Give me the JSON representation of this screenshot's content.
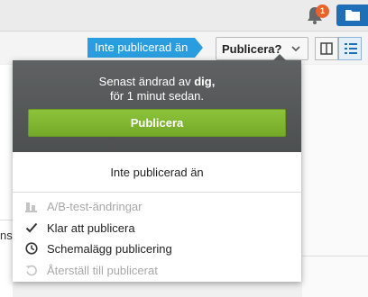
{
  "topbar": {
    "notification_count": "1"
  },
  "toolbar": {
    "status_tag": "Inte publicerad än",
    "publish_select_label": "Publicera?"
  },
  "background": {
    "left_text": "nst"
  },
  "popover": {
    "last_changed_prefix": "Senast ändrad av ",
    "last_changed_user": "dig,",
    "last_changed_time": "för 1 minut sedan.",
    "publish_button": "Publicera",
    "status": "Inte publicerad än",
    "menu": [
      {
        "label": "A/B-test-ändringar",
        "icon": "ab-test-icon",
        "enabled": false
      },
      {
        "label": "Klar att publicera",
        "icon": "checkmark-icon",
        "enabled": true
      },
      {
        "label": "Schemalägg publicering",
        "icon": "clock-icon",
        "enabled": true
      },
      {
        "label": "Återställ till publicerat",
        "icon": "revert-icon",
        "enabled": false
      }
    ]
  },
  "colors": {
    "status_tag": "#2a9dde",
    "publish_button": "#7fb631",
    "popover_header": "#575a5a",
    "badge": "#e8622c",
    "folder_button": "#1f6fb8"
  }
}
